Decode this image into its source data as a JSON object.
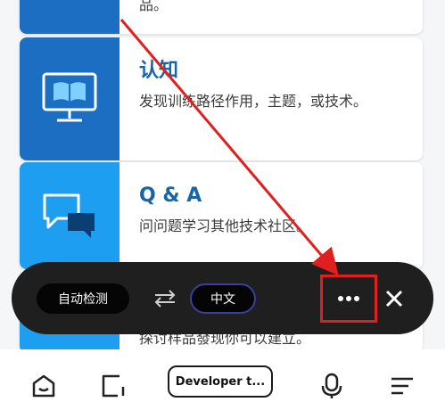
{
  "cards": [
    {
      "title": "",
      "description": "品。",
      "accent": "#1b6ec2"
    },
    {
      "title": "认知",
      "description": "发现训练路径作用，主题，或技术。",
      "icon": "monitor-book-icon",
      "accent": "#1b6ec2"
    },
    {
      "title": "Q & A",
      "description": "问问题学习其他技术社区。",
      "icon": "chat-bubbles-icon",
      "accent": "#1d9ef0"
    },
    {
      "title": "",
      "description": "探讨样品發现你可以建立。",
      "accent": "#1d9ef0"
    }
  ],
  "translate_bar": {
    "source_lang": "自动检测",
    "target_lang": "中文",
    "swap_icon": "swap-arrows-icon",
    "more_icon": "more-dots-icon",
    "close_icon": "close-icon",
    "highlight_color": "#e02020"
  },
  "browser_nav": {
    "home_icon": "home-icon",
    "tabs_icon": "tabs-icon",
    "address_text": "Developer t...",
    "mic_icon": "microphone-icon",
    "menu_icon": "menu-icon"
  }
}
